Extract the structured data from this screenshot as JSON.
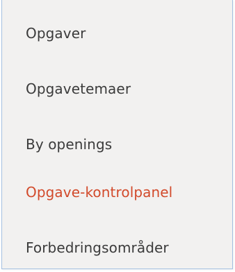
{
  "menu": {
    "items": [
      {
        "label": "Opgaver",
        "active": false
      },
      {
        "label": "Opgavetemaer",
        "active": false
      },
      {
        "label": "By openings",
        "active": false
      },
      {
        "label": "Opgave-kontrolpanel",
        "active": true
      },
      {
        "label": "Forbedringsområder",
        "active": false
      }
    ]
  },
  "colors": {
    "text": "#3b3b3b",
    "active_text": "#d24a2b",
    "panel_background": "#f2f1f0",
    "panel_border": "#a3bfe0"
  }
}
